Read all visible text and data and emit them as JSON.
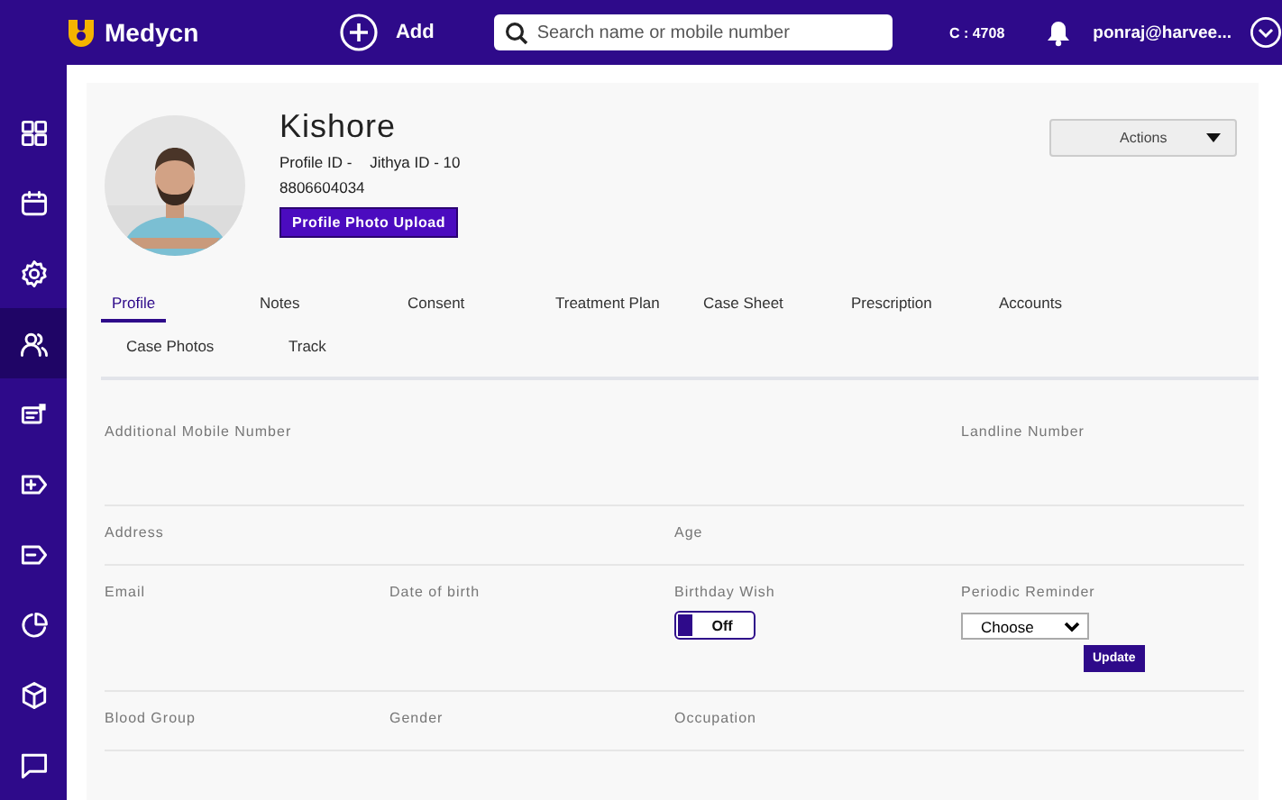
{
  "header": {
    "brand": "Medycn",
    "add_label": "Add",
    "search": {
      "placeholder": "Search name or mobile number"
    },
    "counter": "C : 4708",
    "user": "ponraj@harvee..."
  },
  "sidebar": {
    "items": [
      {
        "selected": false
      },
      {
        "selected": false
      },
      {
        "selected": false
      },
      {
        "selected": true
      },
      {
        "selected": false
      },
      {
        "selected": false
      },
      {
        "selected": false
      },
      {
        "selected": false
      },
      {
        "selected": false
      },
      {
        "selected": false
      }
    ]
  },
  "profile": {
    "name": "Kishore",
    "profile_id": "Profile ID -",
    "jithya_id": "Jithya ID - 10",
    "phone": "8806604034",
    "upload_button": "Profile Photo Upload",
    "actions_button": "Actions"
  },
  "tabs": [
    {
      "label": "Profile",
      "selected": true
    },
    {
      "label": "Notes",
      "selected": false
    },
    {
      "label": "Consent",
      "selected": false
    },
    {
      "label": "Treatment Plan",
      "selected": false
    },
    {
      "label": "Case Sheet",
      "selected": false
    },
    {
      "label": "Prescription",
      "selected": false
    },
    {
      "label": "Accounts",
      "selected": false
    },
    {
      "label": "Case Photos",
      "selected": false
    },
    {
      "label": "Track",
      "selected": false
    }
  ],
  "form_rows": [
    {
      "cells": [
        {
          "kind": "text",
          "label": "Additional Mobile Number"
        },
        null,
        null,
        {
          "kind": "text",
          "label": "Landline Number"
        }
      ]
    },
    {
      "cells": [
        {
          "kind": "text",
          "label": "Address"
        },
        null,
        {
          "kind": "text",
          "label": "Age"
        },
        null
      ]
    },
    {
      "cells": [
        {
          "kind": "text",
          "label": "Email"
        },
        {
          "kind": "text",
          "label": "Date of birth"
        },
        {
          "kind": "toggle",
          "label": "Birthday Wish",
          "on": false,
          "state_text": "Off"
        },
        {
          "kind": "select",
          "label": "Periodic Reminder",
          "value": "Choose",
          "button": "Update"
        }
      ]
    },
    {
      "cells": [
        {
          "kind": "text",
          "label": "Blood Group"
        },
        {
          "kind": "text",
          "label": "Gender"
        },
        {
          "kind": "text",
          "label": "Occupation"
        },
        null
      ]
    }
  ]
}
